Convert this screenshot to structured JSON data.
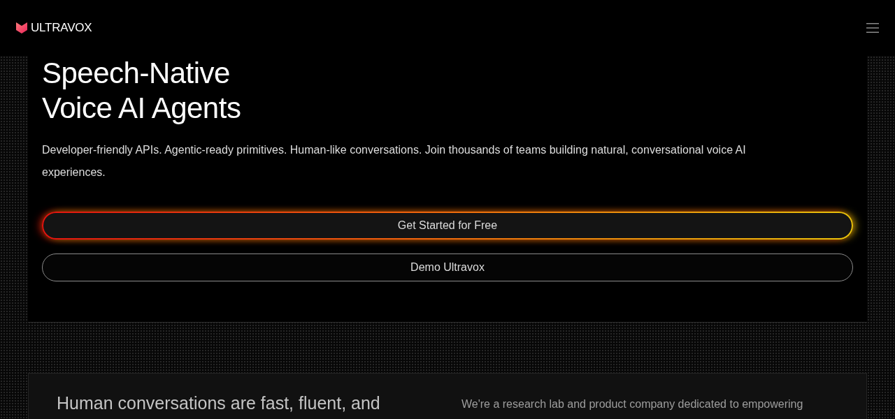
{
  "nav": {
    "logo_text": "ULTRAVOX"
  },
  "hero": {
    "title_lines": [
      "Speech-Native",
      "Voice AI Agents"
    ],
    "description": "Developer-friendly APIs. Agentic-ready primitives. Human-like conversations. Join thousands of teams building natural, conversational voice AI experiences.",
    "buttons": [
      {
        "label": "Get Started for Free",
        "kind": "primary"
      },
      {
        "label": "Demo Ultravox",
        "kind": "secondary"
      }
    ]
  },
  "about": {
    "heading": "Human conversations are fast, fluent, and",
    "text": "We're a research lab and product company dedicated to empowering"
  }
}
